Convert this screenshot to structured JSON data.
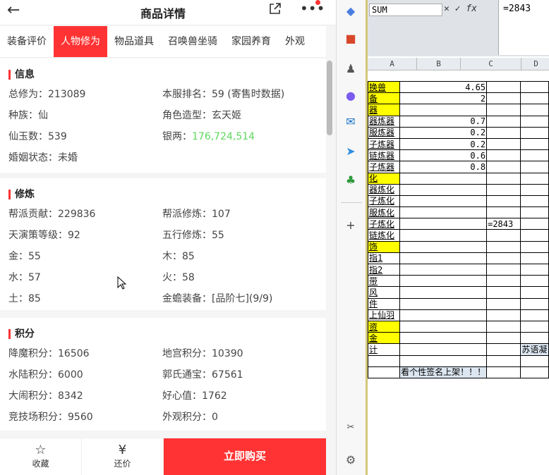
{
  "header": {
    "title": "商品详情"
  },
  "tabs": [
    "装备评价",
    "人物修为",
    "物品道具",
    "召唤兽坐骑",
    "家园养育",
    "外观"
  ],
  "active_tab": 1,
  "sections": [
    {
      "title": "信息",
      "items": [
        "总修为：213089",
        "本服排名：59 (寄售时数据)",
        "种族：仙",
        "角色造型：玄天姬",
        "仙玉数：539",
        "银两：",
        "婚姻状态：未婚",
        ""
      ],
      "silver": "176,724,514"
    },
    {
      "title": "修炼",
      "items": [
        "帮派贡献：229836",
        "帮派修炼：107",
        "天演策等级：92",
        "五行修炼：55",
        "金：55",
        "木：85",
        "水：57",
        "火：58",
        "土：85",
        "金蟾装备：[品阶七](9/9)"
      ]
    },
    {
      "title": "积分",
      "items": [
        "降魔积分：16506",
        "地宫积分：10390",
        "水陆积分：6000",
        "郭氏通宝：67561",
        "大闹积分：8342",
        "好心值：1762",
        "竞技场积分：9560",
        "外观积分：0"
      ]
    }
  ],
  "bottom": {
    "favorite": "收藏",
    "bargain": "还价",
    "buy": "立即购买"
  },
  "excel": {
    "name_box": "SUM",
    "formula": "=2843",
    "columns": [
      "A",
      "B",
      "C",
      "D"
    ],
    "rows": [
      {
        "a": "换兽",
        "b": "4.65",
        "y": true
      },
      {
        "a": "备",
        "b": "2",
        "y": true
      },
      {
        "a": "器",
        "y": true
      },
      {
        "a": "器炼器",
        "b": "0.7"
      },
      {
        "a": "服炼器",
        "b": "0.2"
      },
      {
        "a": "子炼器",
        "b": "0.2"
      },
      {
        "a": "链炼器",
        "b": "0.6"
      },
      {
        "a": "子炼器",
        "b": "0.8"
      },
      {
        "a": "化",
        "y": true
      },
      {
        "a": "器炼化"
      },
      {
        "a": "子炼化"
      },
      {
        "a": "服炼化"
      },
      {
        "a": "子炼化",
        "c": "=2843"
      },
      {
        "a": "链炼化"
      },
      {
        "a": "饰",
        "y": true
      },
      {
        "a": "指1"
      },
      {
        "a": "指2"
      },
      {
        "a": "带"
      },
      {
        "a": "风"
      },
      {
        "a": "件"
      },
      {
        "a": "上仙羽"
      },
      {
        "a": "资",
        "y": true
      },
      {
        "a": "金",
        "y": true
      },
      {
        "a": "计",
        "d": "苏语凝"
      },
      {
        "a": ""
      },
      {
        "a": "",
        "b": "看个性签名上架！！！"
      }
    ]
  }
}
